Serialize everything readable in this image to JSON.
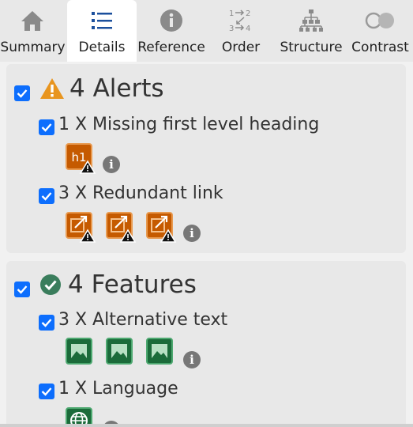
{
  "tabs": [
    {
      "label": "Summary",
      "icon": "home-icon",
      "active": false
    },
    {
      "label": "Details",
      "icon": "list-icon",
      "active": true
    },
    {
      "label": "Reference",
      "icon": "info-icon",
      "active": false
    },
    {
      "label": "Order",
      "icon": "order-icon",
      "active": false
    },
    {
      "label": "Structure",
      "icon": "structure-icon",
      "active": false
    },
    {
      "label": "Contrast",
      "icon": "contrast-icon",
      "active": false
    }
  ],
  "alerts": {
    "title": "4 Alerts",
    "checked": true,
    "icon": "warning-icon",
    "items": [
      {
        "label": "1 X Missing first level heading",
        "icon_text": "h1",
        "icon": "missing-heading-icon",
        "count": 1,
        "checked": true
      },
      {
        "label": "3 X Redundant link",
        "icon": "redundant-link-icon",
        "count": 3,
        "checked": true
      }
    ]
  },
  "features": {
    "title": "4 Features",
    "checked": true,
    "icon": "check-circle-icon",
    "items": [
      {
        "label": "3 X Alternative text",
        "icon": "image-icon",
        "count": 3,
        "checked": true
      },
      {
        "label": "1 X Language",
        "icon": "globe-icon",
        "count": 1,
        "checked": true
      }
    ]
  },
  "colors": {
    "accent": "#0d6efd",
    "alert_orange": "#c55a00",
    "warning_triangle": "#e8951f",
    "feature_green": "#1b6b3a",
    "check_green": "#3a7d5c"
  }
}
